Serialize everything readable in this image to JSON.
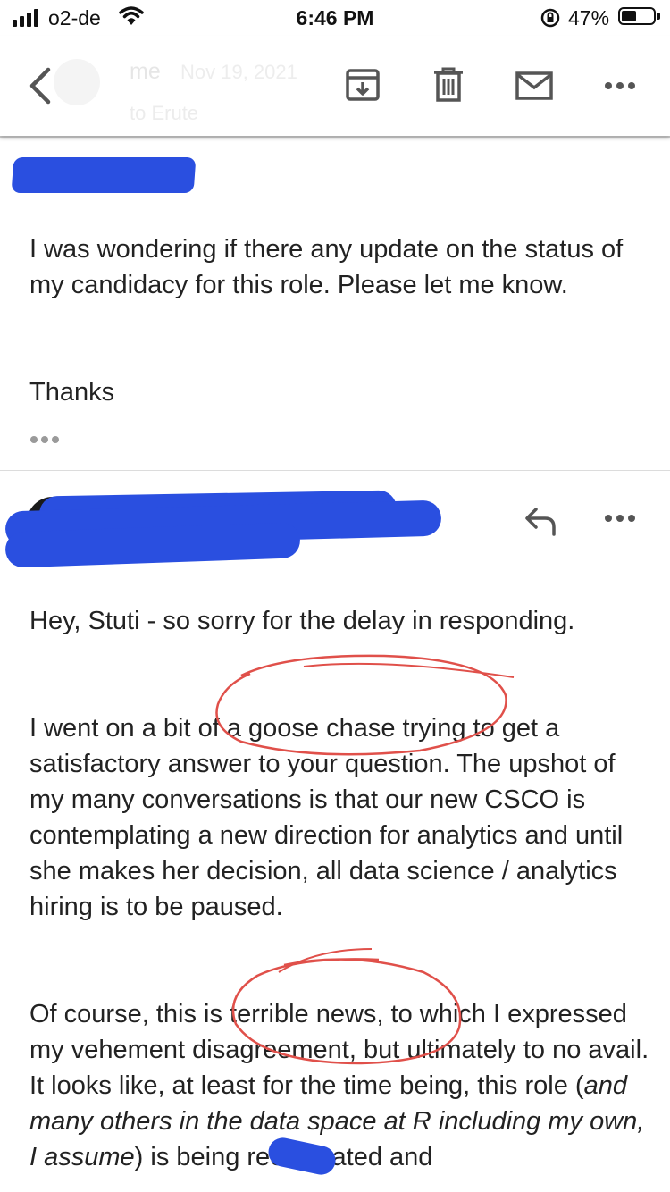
{
  "status_bar": {
    "carrier": "o2-de",
    "time": "6:46 PM",
    "battery_percent": "47%",
    "battery_level": 0.47
  },
  "header": {
    "sender": "me",
    "date": "Nov 19, 2021",
    "recipient": "to Erute",
    "icons": [
      "back-icon",
      "archive-icon",
      "trash-icon",
      "mail-icon",
      "more-icon"
    ]
  },
  "message1": {
    "body": "I was wondering if there any update on the status of my candidacy for this role. Please let me know.",
    "closing": "Thanks"
  },
  "message2": {
    "greeting": "Hey, Stuti - so sorry for the delay in responding.",
    "paragraph2": "I went on a bit of a goose chase trying to get a satisfactory answer to your question.  The upshot of my many conversations is that our new CSCO is contemplating a new direction for analytics and until she makes her decision, all data science / analytics hiring is to be paused.",
    "paragraph3_a": "Of course, this is terrible news, to which I expressed my vehement disagreement, but ultimately to no avail.  It looks like, at least for the time being, this role (",
    "paragraph3_italic": "and many others in the data space at R",
    "paragraph3_italic2": " including my own, I assume",
    "paragraph3_b": ") is being reevaluated and"
  },
  "colors": {
    "redaction": "#2a4fe0",
    "annotation_circle": "#e0504a"
  }
}
